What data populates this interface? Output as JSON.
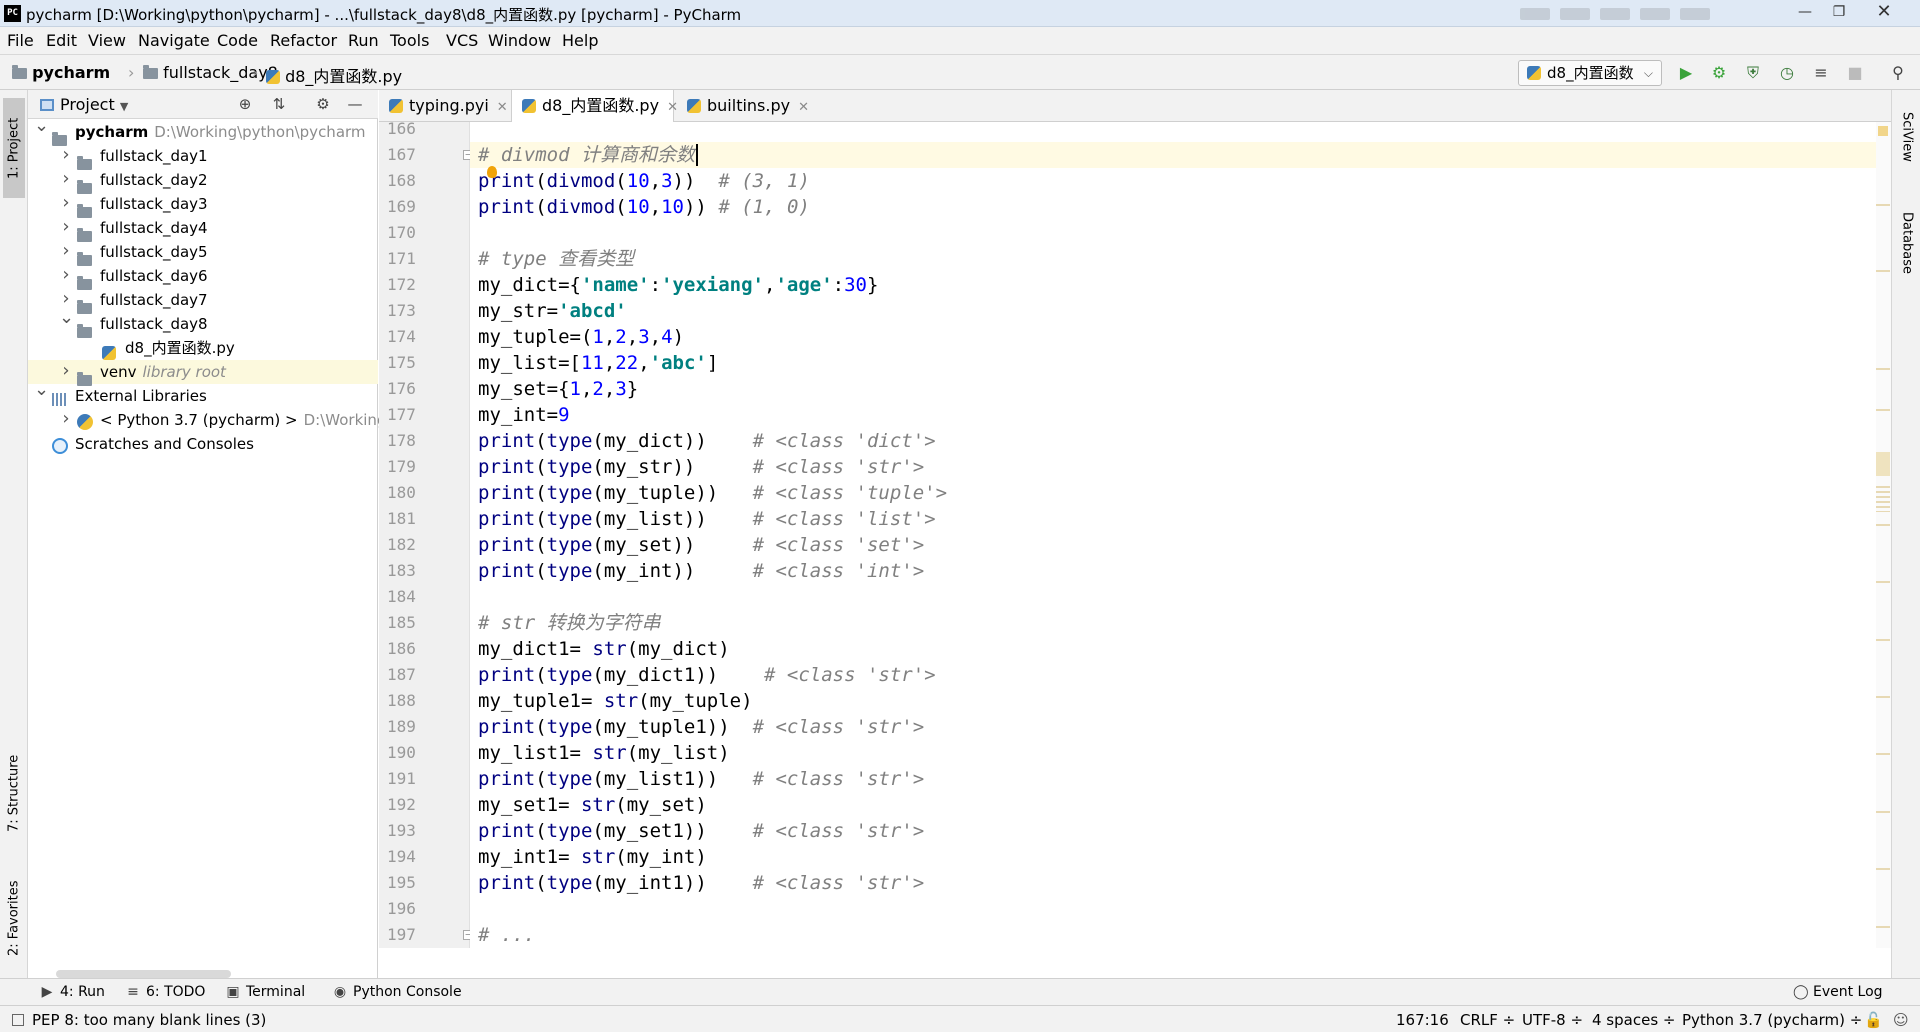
{
  "window": {
    "title": "pycharm [D:\\Working\\python\\pycharm] - ...\\fullstack_day8\\d8_内置函数.py [pycharm] - PyCharm",
    "app_icon": "PC"
  },
  "menu": [
    "File",
    "Edit",
    "View",
    "Navigate",
    "Code",
    "Refactor",
    "Run",
    "Tools",
    "VCS",
    "Window",
    "Help"
  ],
  "breadcrumb": [
    "pycharm",
    "fullstack_day8",
    "d8_内置函数.py"
  ],
  "run_config": "d8_内置函数",
  "left_tool_tabs": [
    "1: Project",
    "7: Structure",
    "2: Favorites"
  ],
  "right_tool_tabs": [
    "SciView",
    "Database"
  ],
  "project_panel": {
    "title": "Project",
    "tree": [
      {
        "label": "pycharm",
        "extra": "D:\\Working\\python\\pycharm",
        "depth": 0,
        "arrow": "down",
        "icon": "folder-icon",
        "bold": true
      },
      {
        "label": "fullstack_day1",
        "depth": 1,
        "arrow": "right",
        "icon": "folder-icon"
      },
      {
        "label": "fullstack_day2",
        "depth": 1,
        "arrow": "right",
        "icon": "folder-icon"
      },
      {
        "label": "fullstack_day3",
        "depth": 1,
        "arrow": "right",
        "icon": "folder-icon"
      },
      {
        "label": "fullstack_day4",
        "depth": 1,
        "arrow": "right",
        "icon": "folder-icon"
      },
      {
        "label": "fullstack_day5",
        "depth": 1,
        "arrow": "right",
        "icon": "folder-icon"
      },
      {
        "label": "fullstack_day6",
        "depth": 1,
        "arrow": "right",
        "icon": "folder-icon"
      },
      {
        "label": "fullstack_day7",
        "depth": 1,
        "arrow": "right",
        "icon": "folder-icon"
      },
      {
        "label": "fullstack_day8",
        "depth": 1,
        "arrow": "down",
        "icon": "folder-icon"
      },
      {
        "label": "d8_内置函数.py",
        "depth": 2,
        "arrow": "",
        "icon": "python-file-icon"
      },
      {
        "label": "venv",
        "extra": "library root",
        "depth": 1,
        "arrow": "right",
        "icon": "folder-icon",
        "venv": true
      },
      {
        "label": "External Libraries",
        "depth": 0,
        "arrow": "down",
        "icon": "library-icon"
      },
      {
        "label": "< Python 3.7 (pycharm) >",
        "extra": "D:\\Working",
        "depth": 1,
        "arrow": "right",
        "icon": "python-sdk-icon"
      },
      {
        "label": "Scratches and Consoles",
        "depth": 0,
        "arrow": "",
        "icon": "scratch-icon"
      }
    ]
  },
  "tabs": [
    {
      "label": "typing.pyi",
      "active": false
    },
    {
      "label": "d8_内置函数.py",
      "active": true
    },
    {
      "label": "builtins.py",
      "active": false
    }
  ],
  "editor": {
    "lines": [
      {
        "n": "166",
        "tokens": []
      },
      {
        "n": "167",
        "tokens": [
          [
            "cmt",
            "# divmod 计算商和余数"
          ]
        ]
      },
      {
        "n": "168",
        "tokens": [
          [
            "kw-b",
            "print"
          ],
          [
            "",
            "("
          ],
          [
            "kw-b",
            "divmod"
          ],
          [
            "",
            "("
          ],
          [
            "num",
            "10"
          ],
          [
            "",
            ","
          ],
          [
            "num",
            "3"
          ],
          [
            "",
            "))  "
          ],
          [
            "cmt",
            "# (3, 1)"
          ]
        ]
      },
      {
        "n": "169",
        "tokens": [
          [
            "kw-b",
            "print"
          ],
          [
            "",
            "("
          ],
          [
            "kw-b",
            "divmod"
          ],
          [
            "",
            "("
          ],
          [
            "num",
            "10"
          ],
          [
            "",
            ","
          ],
          [
            "num",
            "10"
          ],
          [
            "",
            ")) "
          ],
          [
            "cmt",
            "# (1, 0)"
          ]
        ]
      },
      {
        "n": "170",
        "tokens": []
      },
      {
        "n": "171",
        "tokens": [
          [
            "cmt",
            "# type 查看类型"
          ]
        ]
      },
      {
        "n": "172",
        "tokens": [
          [
            "",
            "my_dict={"
          ],
          [
            "str",
            "'name'"
          ],
          [
            "",
            ":"
          ],
          [
            "str",
            "'yexiang'"
          ],
          [
            "",
            ","
          ],
          [
            "str",
            "'age'"
          ],
          [
            "",
            ":"
          ],
          [
            "num",
            "30"
          ],
          [
            "",
            "}"
          ]
        ]
      },
      {
        "n": "173",
        "tokens": [
          [
            "",
            "my_str="
          ],
          [
            "str",
            "'abcd'"
          ]
        ]
      },
      {
        "n": "174",
        "tokens": [
          [
            "",
            "my_tuple=("
          ],
          [
            "num",
            "1"
          ],
          [
            "",
            ","
          ],
          [
            "num",
            "2"
          ],
          [
            "",
            ","
          ],
          [
            "num",
            "3"
          ],
          [
            "",
            ","
          ],
          [
            "num",
            "4"
          ],
          [
            "",
            ")"
          ]
        ]
      },
      {
        "n": "175",
        "tokens": [
          [
            "",
            "my_list=["
          ],
          [
            "num",
            "11"
          ],
          [
            "",
            ","
          ],
          [
            "num",
            "22"
          ],
          [
            "",
            ","
          ],
          [
            "str",
            "'abc'"
          ],
          [
            "",
            "]"
          ]
        ]
      },
      {
        "n": "176",
        "tokens": [
          [
            "",
            "my_set={"
          ],
          [
            "num",
            "1"
          ],
          [
            "",
            ","
          ],
          [
            "num",
            "2"
          ],
          [
            "",
            ","
          ],
          [
            "num",
            "3"
          ],
          [
            "",
            "}"
          ]
        ]
      },
      {
        "n": "177",
        "tokens": [
          [
            "",
            "my_int="
          ],
          [
            "num",
            "9"
          ]
        ]
      },
      {
        "n": "178",
        "tokens": [
          [
            "kw-b",
            "print"
          ],
          [
            "",
            "("
          ],
          [
            "kw-b",
            "type"
          ],
          [
            "",
            "(my_dict))    "
          ],
          [
            "cmt",
            "# <class 'dict'>"
          ]
        ]
      },
      {
        "n": "179",
        "tokens": [
          [
            "kw-b",
            "print"
          ],
          [
            "",
            "("
          ],
          [
            "kw-b",
            "type"
          ],
          [
            "",
            "(my_str))     "
          ],
          [
            "cmt",
            "# <class 'str'>"
          ]
        ]
      },
      {
        "n": "180",
        "tokens": [
          [
            "kw-b",
            "print"
          ],
          [
            "",
            "("
          ],
          [
            "kw-b",
            "type"
          ],
          [
            "",
            "(my_tuple))   "
          ],
          [
            "cmt",
            "# <class 'tuple'>"
          ]
        ]
      },
      {
        "n": "181",
        "tokens": [
          [
            "kw-b",
            "print"
          ],
          [
            "",
            "("
          ],
          [
            "kw-b",
            "type"
          ],
          [
            "",
            "(my_list))    "
          ],
          [
            "cmt",
            "# <class 'list'>"
          ]
        ]
      },
      {
        "n": "182",
        "tokens": [
          [
            "kw-b",
            "print"
          ],
          [
            "",
            "("
          ],
          [
            "kw-b",
            "type"
          ],
          [
            "",
            "(my_set))     "
          ],
          [
            "cmt",
            "# <class 'set'>"
          ]
        ]
      },
      {
        "n": "183",
        "tokens": [
          [
            "kw-b",
            "print"
          ],
          [
            "",
            "("
          ],
          [
            "kw-b",
            "type"
          ],
          [
            "",
            "(my_int))     "
          ],
          [
            "cmt",
            "# <class 'int'>"
          ]
        ]
      },
      {
        "n": "184",
        "tokens": []
      },
      {
        "n": "185",
        "tokens": [
          [
            "cmt",
            "# str 转换为字符串"
          ]
        ]
      },
      {
        "n": "186",
        "tokens": [
          [
            "",
            "my_dict1= "
          ],
          [
            "kw-b",
            "str"
          ],
          [
            "",
            "(my_dict)"
          ]
        ]
      },
      {
        "n": "187",
        "tokens": [
          [
            "kw-b",
            "print"
          ],
          [
            "",
            "("
          ],
          [
            "kw-b",
            "type"
          ],
          [
            "",
            "(my_dict1))    "
          ],
          [
            "cmt",
            "# <class 'str'>"
          ]
        ]
      },
      {
        "n": "188",
        "tokens": [
          [
            "",
            "my_tuple1= "
          ],
          [
            "kw-b",
            "str"
          ],
          [
            "",
            "(my_tuple)"
          ]
        ]
      },
      {
        "n": "189",
        "tokens": [
          [
            "kw-b",
            "print"
          ],
          [
            "",
            "("
          ],
          [
            "kw-b",
            "type"
          ],
          [
            "",
            "(my_tuple1))  "
          ],
          [
            "cmt",
            "# <class 'str'>"
          ]
        ]
      },
      {
        "n": "190",
        "tokens": [
          [
            "",
            "my_list1= "
          ],
          [
            "kw-b",
            "str"
          ],
          [
            "",
            "(my_list)"
          ]
        ]
      },
      {
        "n": "191",
        "tokens": [
          [
            "kw-b",
            "print"
          ],
          [
            "",
            "("
          ],
          [
            "kw-b",
            "type"
          ],
          [
            "",
            "(my_list1))   "
          ],
          [
            "cmt",
            "# <class 'str'>"
          ]
        ]
      },
      {
        "n": "192",
        "tokens": [
          [
            "",
            "my_set1= "
          ],
          [
            "kw-b",
            "str"
          ],
          [
            "",
            "(my_set)"
          ]
        ]
      },
      {
        "n": "193",
        "tokens": [
          [
            "kw-b",
            "print"
          ],
          [
            "",
            "("
          ],
          [
            "kw-b",
            "type"
          ],
          [
            "",
            "(my_set1))    "
          ],
          [
            "cmt",
            "# <class 'str'>"
          ]
        ]
      },
      {
        "n": "194",
        "tokens": [
          [
            "",
            "my_int1= "
          ],
          [
            "kw-b",
            "str"
          ],
          [
            "",
            "(my_int)"
          ]
        ]
      },
      {
        "n": "195",
        "tokens": [
          [
            "kw-b",
            "print"
          ],
          [
            "",
            "("
          ],
          [
            "kw-b",
            "type"
          ],
          [
            "",
            "(my_int1))    "
          ],
          [
            "cmt",
            "# <class 'str'>"
          ]
        ]
      },
      {
        "n": "196",
        "tokens": []
      },
      {
        "n": "197",
        "tokens": [
          [
            "cmt",
            "# ..."
          ]
        ]
      }
    ]
  },
  "bottom_tabs": [
    {
      "label": "4: Run",
      "icon": "run-icon"
    },
    {
      "label": "6: TODO",
      "icon": "todo-icon"
    },
    {
      "label": "Terminal",
      "icon": "terminal-icon"
    },
    {
      "label": "Python Console",
      "icon": "python-console-icon"
    }
  ],
  "event_log": "Event Log",
  "status": {
    "message": "PEP 8: too many blank lines (3)",
    "position": "167:16",
    "line_sep": "CRLF ÷",
    "encoding": "UTF-8 ÷",
    "indent": "4 spaces ÷",
    "interpreter": "Python 3.7 (pycharm) ÷"
  },
  "colors": {
    "keyword_blue": "#000080",
    "number": "#0000ff",
    "string": "#008080",
    "comment": "#808080",
    "current_line": "#fffae3",
    "run_green": "#3aa33a"
  }
}
